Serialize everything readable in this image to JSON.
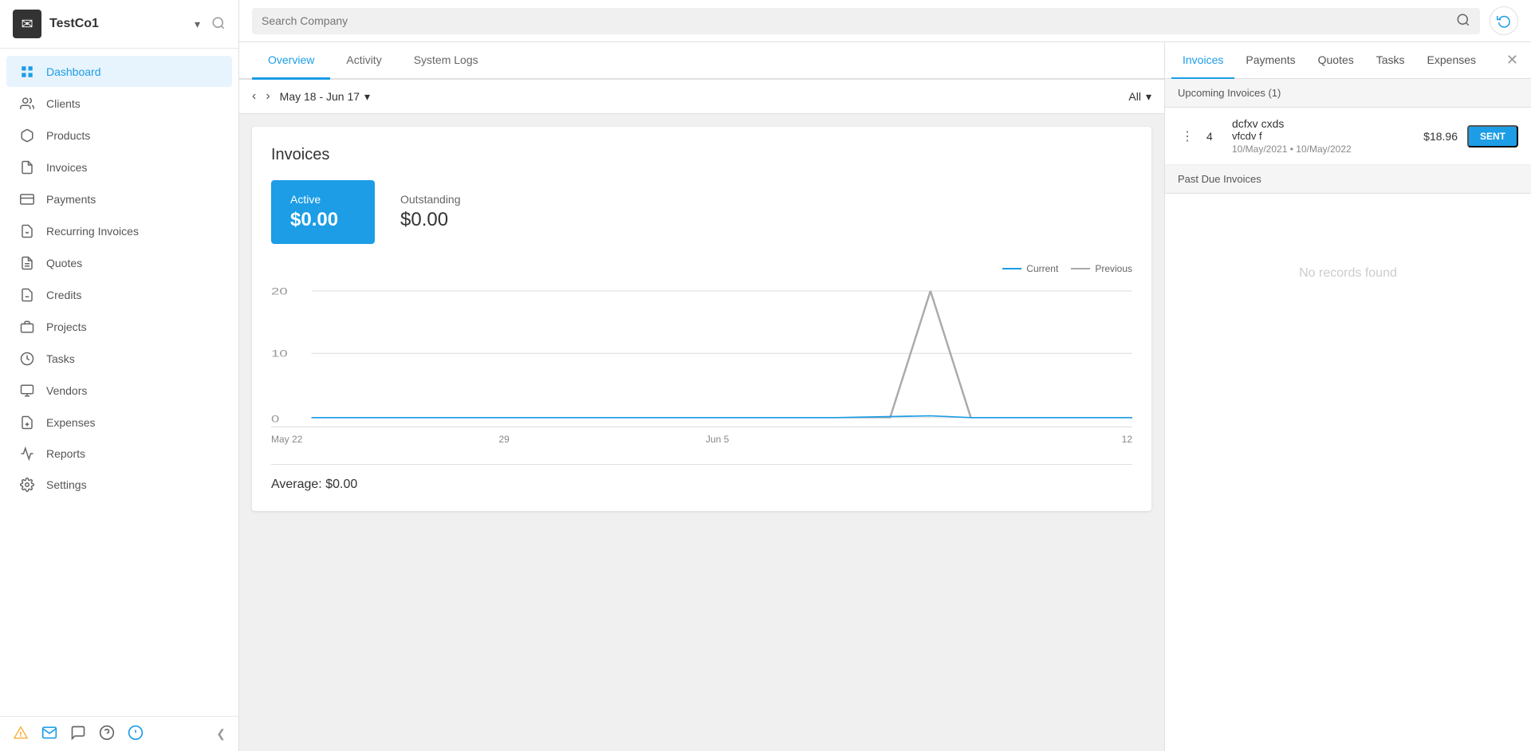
{
  "sidebar": {
    "company_name": "TestCo1",
    "nav_items": [
      {
        "id": "dashboard",
        "label": "Dashboard",
        "active": true,
        "icon": "grid"
      },
      {
        "id": "clients",
        "label": "Clients",
        "active": false,
        "icon": "people"
      },
      {
        "id": "products",
        "label": "Products",
        "active": false,
        "icon": "box"
      },
      {
        "id": "invoices",
        "label": "Invoices",
        "active": false,
        "icon": "doc"
      },
      {
        "id": "payments",
        "label": "Payments",
        "active": false,
        "icon": "card"
      },
      {
        "id": "recurring",
        "label": "Recurring Invoices",
        "active": false,
        "icon": "recurring"
      },
      {
        "id": "quotes",
        "label": "Quotes",
        "active": false,
        "icon": "quote"
      },
      {
        "id": "credits",
        "label": "Credits",
        "active": false,
        "icon": "credit"
      },
      {
        "id": "projects",
        "label": "Projects",
        "active": false,
        "icon": "briefcase"
      },
      {
        "id": "tasks",
        "label": "Tasks",
        "active": false,
        "icon": "clock"
      },
      {
        "id": "vendors",
        "label": "Vendors",
        "active": false,
        "icon": "vendor"
      },
      {
        "id": "expenses",
        "label": "Expenses",
        "active": false,
        "icon": "expense"
      },
      {
        "id": "reports",
        "label": "Reports",
        "active": false,
        "icon": "chart"
      },
      {
        "id": "settings",
        "label": "Settings",
        "active": false,
        "icon": "gear"
      }
    ]
  },
  "search": {
    "placeholder": "Search Company"
  },
  "dashboard": {
    "tabs": [
      {
        "id": "overview",
        "label": "Overview",
        "active": true
      },
      {
        "id": "activity",
        "label": "Activity",
        "active": false
      },
      {
        "id": "system_logs",
        "label": "System Logs",
        "active": false
      }
    ],
    "date_range": "May 18 - Jun 17",
    "filter": "All",
    "invoices_card": {
      "title": "Invoices",
      "active_label": "Active",
      "active_value": "$0.00",
      "outstanding_label": "Outstanding",
      "outstanding_value": "$0.00",
      "average": "Average: $0.00",
      "chart": {
        "legend_current": "Current",
        "legend_previous": "Previous",
        "y_labels": [
          "20",
          "10",
          "0"
        ],
        "x_labels": [
          "May 22",
          "29",
          "Jun 5",
          "",
          "12"
        ]
      }
    }
  },
  "right_panel": {
    "tabs": [
      {
        "id": "invoices",
        "label": "Invoices",
        "active": true
      },
      {
        "id": "payments",
        "label": "Payments",
        "active": false
      },
      {
        "id": "quotes",
        "label": "Quotes",
        "active": false
      },
      {
        "id": "tasks",
        "label": "Tasks",
        "active": false
      },
      {
        "id": "expenses",
        "label": "Expenses",
        "active": false
      }
    ],
    "upcoming_section": "Upcoming Invoices (1)",
    "invoice": {
      "number": "4",
      "name": "dcfxv cxds",
      "sub": "vfcdv f",
      "date_start": "10/May/2021",
      "date_end": "10/May/2022",
      "amount": "$18.96",
      "status": "SENT"
    },
    "past_due_section": "Past Due Invoices",
    "no_records": "No records found"
  }
}
